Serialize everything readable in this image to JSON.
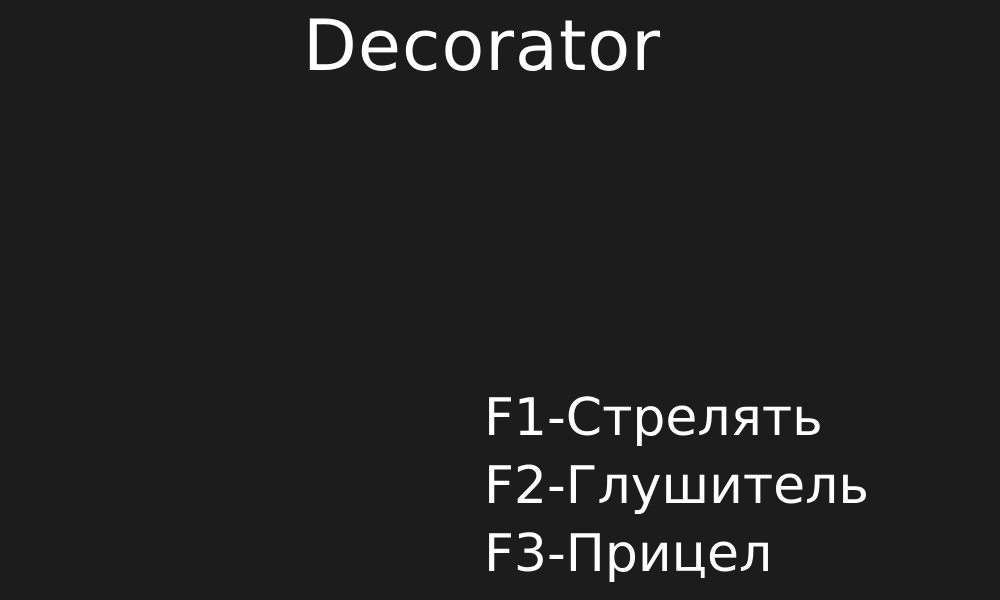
{
  "title": "Decorator",
  "hints": [
    "F1-Стрелять",
    "F2-Глушитель",
    "F3-Прицел"
  ],
  "colors": {
    "background": "#1c1c1c",
    "text": "#ffffff"
  }
}
